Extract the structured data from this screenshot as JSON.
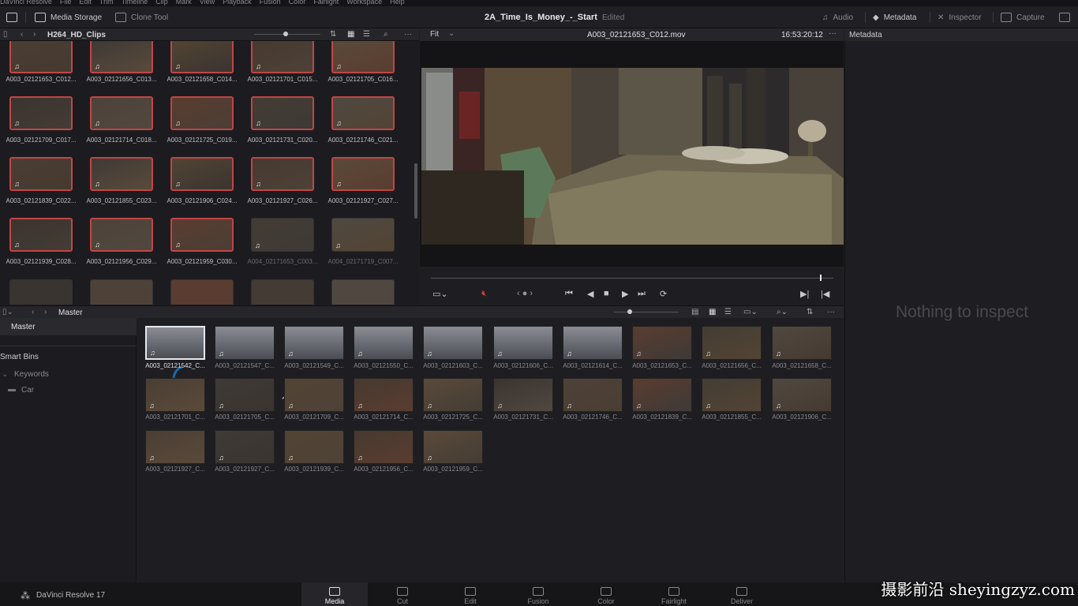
{
  "menu": [
    "DaVinci Resolve",
    "File",
    "Edit",
    "Trim",
    "Timeline",
    "Clip",
    "Mark",
    "View",
    "Playback",
    "Fusion",
    "Color",
    "Fairlight",
    "Workspace",
    "Help"
  ],
  "toolbar": {
    "media_storage": "Media Storage",
    "clone_tool": "Clone Tool",
    "project": "2A_Time_Is_Money_-_Start",
    "status": "Edited",
    "audio": "Audio",
    "metadata": "Metadata",
    "inspector": "Inspector",
    "capture": "Capture"
  },
  "media_panel": {
    "title": "H264_HD_Clips",
    "clips": [
      "A003_02121653_C012...",
      "A003_02121656_C013...",
      "A003_02121658_C014...",
      "A003_02121701_C015...",
      "A003_02121705_C016...",
      "A003_02121709_C017...",
      "A003_02121714_C018...",
      "A003_02121725_C019...",
      "A003_02121731_C020...",
      "A003_02121746_C021...",
      "A003_02121839_C022...",
      "A003_02121855_C023...",
      "A003_02121906_C024...",
      "A003_02121927_C026...",
      "A003_02121927_C027...",
      "A003_02121939_C028...",
      "A003_02121956_C029...",
      "A003_02121959_C030...",
      "A004_02171653_C003...",
      "A004_02171719_C007..."
    ]
  },
  "viewer": {
    "zoom": "Fit",
    "clip": "A003_02121653_C012.mov",
    "timecode": "16:53:20:12"
  },
  "metadata": {
    "title": "Metadata",
    "empty": "Nothing to inspect"
  },
  "pool": {
    "title": "Master",
    "bins": {
      "master": "Master",
      "smart_bins": "Smart Bins",
      "keywords": "Keywords",
      "car": "Car"
    },
    "clips": [
      "A003_02121542_C...",
      "A003_02121547_C...",
      "A003_02121549_C...",
      "A003_02121550_C...",
      "A003_02121603_C...",
      "A003_02121606_C...",
      "A003_02121614_C...",
      "A003_02121653_C...",
      "A003_02121656_C...",
      "A003_02121658_C...",
      "A003_02121701_C...",
      "A003_02121705_C...",
      "A003_02121709_C...",
      "A003_02121714_C...",
      "A003_02121725_C...",
      "A003_02121731_C...",
      "A003_02121746_C...",
      "A003_02121839_C...",
      "A003_02121855_C...",
      "A003_02121906_C...",
      "A003_02121927_C...",
      "A003_02121927_C...",
      "A003_02121939_C...",
      "A003_02121956_C...",
      "A003_02121959_C..."
    ]
  },
  "pages": {
    "app": "DaVinci Resolve 17",
    "media": "Media",
    "cut": "Cut",
    "edit": "Edit",
    "fusion": "Fusion",
    "color": "Color",
    "fairlight": "Fairlight",
    "deliver": "Deliver"
  },
  "watermark": "摄影前沿 sheyingzyz.com"
}
